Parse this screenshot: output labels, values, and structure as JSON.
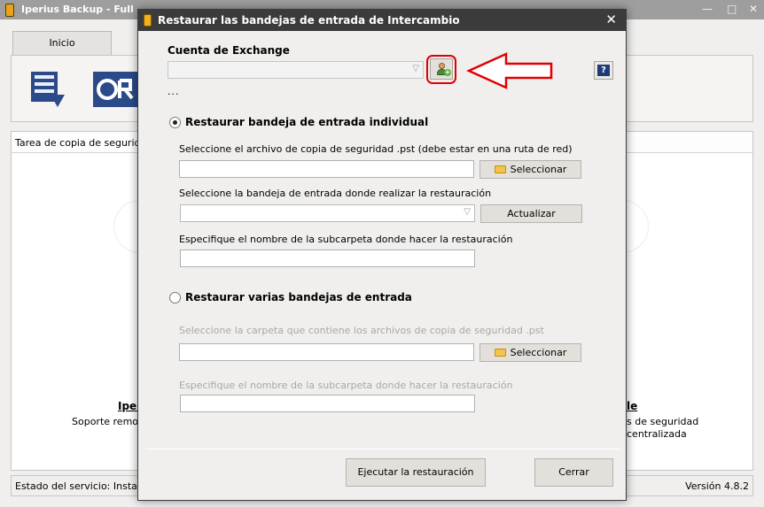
{
  "main_window": {
    "title": "Iperius Backup - Full",
    "controls": [
      "—",
      "□",
      "✕"
    ],
    "tab_home": "Inicio",
    "tasks_header": "Tarea de copia de seguridad",
    "left_card_title": "Iperi",
    "left_card_desc": "Soporte remoto",
    "right_card_title": "le",
    "right_card_desc": "s de seguridad centralizada",
    "status_text": "Estado del servicio: Instalado",
    "version": "Versión 4.8.2"
  },
  "dialog": {
    "title": "Restaurar las bandejas de entrada de Intercambio",
    "close_symbol": "✕",
    "exchange_account_label": "Cuenta de Exchange",
    "exchange_account_value": "",
    "ellipsis": "...",
    "help_symbol": "?",
    "single": {
      "radio_label": "Restaurar bandeja de entrada individual",
      "checked": true,
      "pst_label": "Seleccione el archivo de copia de seguridad .pst (debe estar en una ruta de red)",
      "pst_value": "",
      "select_button": "Seleccionar",
      "mailbox_label": "Seleccione la bandeja de entrada donde realizar la restauración",
      "mailbox_value": "",
      "refresh_button": "Actualizar",
      "subfolder_label": "Especifique el nombre de la subcarpeta donde hacer la restauración",
      "subfolder_value": ""
    },
    "multiple": {
      "radio_label": "Restaurar varias bandejas de entrada",
      "checked": false,
      "folder_label": "Seleccione la carpeta que contiene los archivos de copia de seguridad .pst",
      "folder_value": "",
      "select_button": "Seleccionar",
      "subfolder_label": "Especifique el nombre de la subcarpeta donde hacer la restauración",
      "subfolder_value": ""
    },
    "run_button": "Ejecutar la restauración",
    "close_button": "Cerrar"
  },
  "icons": {
    "app": "iperius-app-icon",
    "add_account": "add-user-icon",
    "help": "help-icon",
    "folder": "folder-icon",
    "dropdown": "chevron-down-icon",
    "annotation": "red-arrow-annotation"
  },
  "colors": {
    "dialog_title_bg": "#3b3b3b",
    "annotation_red": "#e00000",
    "folder_yellow": "#f2c54a"
  }
}
